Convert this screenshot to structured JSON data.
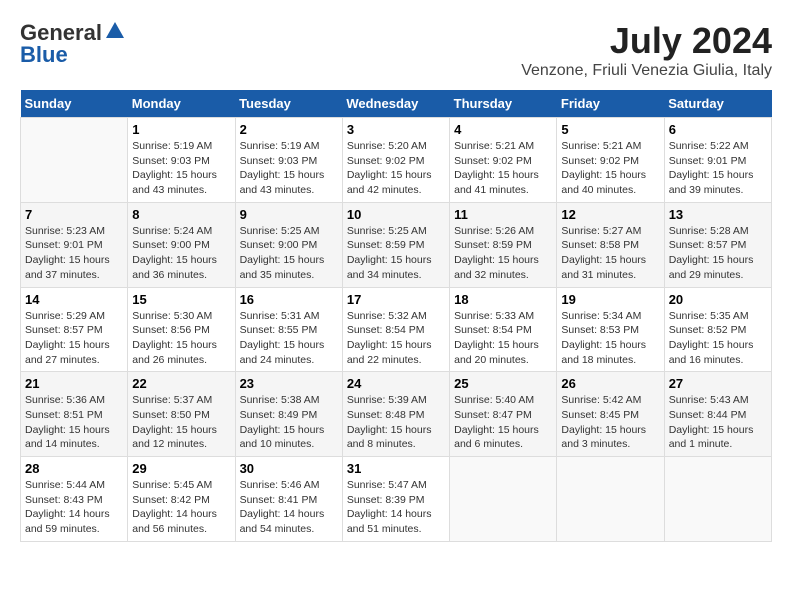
{
  "header": {
    "logo_general": "General",
    "logo_blue": "Blue",
    "month": "July 2024",
    "location": "Venzone, Friuli Venezia Giulia, Italy"
  },
  "weekdays": [
    "Sunday",
    "Monday",
    "Tuesday",
    "Wednesday",
    "Thursday",
    "Friday",
    "Saturday"
  ],
  "weeks": [
    [
      {
        "day": "",
        "sunrise": "",
        "sunset": "",
        "daylight": ""
      },
      {
        "day": "1",
        "sunrise": "Sunrise: 5:19 AM",
        "sunset": "Sunset: 9:03 PM",
        "daylight": "Daylight: 15 hours and 43 minutes."
      },
      {
        "day": "2",
        "sunrise": "Sunrise: 5:19 AM",
        "sunset": "Sunset: 9:03 PM",
        "daylight": "Daylight: 15 hours and 43 minutes."
      },
      {
        "day": "3",
        "sunrise": "Sunrise: 5:20 AM",
        "sunset": "Sunset: 9:02 PM",
        "daylight": "Daylight: 15 hours and 42 minutes."
      },
      {
        "day": "4",
        "sunrise": "Sunrise: 5:21 AM",
        "sunset": "Sunset: 9:02 PM",
        "daylight": "Daylight: 15 hours and 41 minutes."
      },
      {
        "day": "5",
        "sunrise": "Sunrise: 5:21 AM",
        "sunset": "Sunset: 9:02 PM",
        "daylight": "Daylight: 15 hours and 40 minutes."
      },
      {
        "day": "6",
        "sunrise": "Sunrise: 5:22 AM",
        "sunset": "Sunset: 9:01 PM",
        "daylight": "Daylight: 15 hours and 39 minutes."
      }
    ],
    [
      {
        "day": "7",
        "sunrise": "Sunrise: 5:23 AM",
        "sunset": "Sunset: 9:01 PM",
        "daylight": "Daylight: 15 hours and 37 minutes."
      },
      {
        "day": "8",
        "sunrise": "Sunrise: 5:24 AM",
        "sunset": "Sunset: 9:00 PM",
        "daylight": "Daylight: 15 hours and 36 minutes."
      },
      {
        "day": "9",
        "sunrise": "Sunrise: 5:25 AM",
        "sunset": "Sunset: 9:00 PM",
        "daylight": "Daylight: 15 hours and 35 minutes."
      },
      {
        "day": "10",
        "sunrise": "Sunrise: 5:25 AM",
        "sunset": "Sunset: 8:59 PM",
        "daylight": "Daylight: 15 hours and 34 minutes."
      },
      {
        "day": "11",
        "sunrise": "Sunrise: 5:26 AM",
        "sunset": "Sunset: 8:59 PM",
        "daylight": "Daylight: 15 hours and 32 minutes."
      },
      {
        "day": "12",
        "sunrise": "Sunrise: 5:27 AM",
        "sunset": "Sunset: 8:58 PM",
        "daylight": "Daylight: 15 hours and 31 minutes."
      },
      {
        "day": "13",
        "sunrise": "Sunrise: 5:28 AM",
        "sunset": "Sunset: 8:57 PM",
        "daylight": "Daylight: 15 hours and 29 minutes."
      }
    ],
    [
      {
        "day": "14",
        "sunrise": "Sunrise: 5:29 AM",
        "sunset": "Sunset: 8:57 PM",
        "daylight": "Daylight: 15 hours and 27 minutes."
      },
      {
        "day": "15",
        "sunrise": "Sunrise: 5:30 AM",
        "sunset": "Sunset: 8:56 PM",
        "daylight": "Daylight: 15 hours and 26 minutes."
      },
      {
        "day": "16",
        "sunrise": "Sunrise: 5:31 AM",
        "sunset": "Sunset: 8:55 PM",
        "daylight": "Daylight: 15 hours and 24 minutes."
      },
      {
        "day": "17",
        "sunrise": "Sunrise: 5:32 AM",
        "sunset": "Sunset: 8:54 PM",
        "daylight": "Daylight: 15 hours and 22 minutes."
      },
      {
        "day": "18",
        "sunrise": "Sunrise: 5:33 AM",
        "sunset": "Sunset: 8:54 PM",
        "daylight": "Daylight: 15 hours and 20 minutes."
      },
      {
        "day": "19",
        "sunrise": "Sunrise: 5:34 AM",
        "sunset": "Sunset: 8:53 PM",
        "daylight": "Daylight: 15 hours and 18 minutes."
      },
      {
        "day": "20",
        "sunrise": "Sunrise: 5:35 AM",
        "sunset": "Sunset: 8:52 PM",
        "daylight": "Daylight: 15 hours and 16 minutes."
      }
    ],
    [
      {
        "day": "21",
        "sunrise": "Sunrise: 5:36 AM",
        "sunset": "Sunset: 8:51 PM",
        "daylight": "Daylight: 15 hours and 14 minutes."
      },
      {
        "day": "22",
        "sunrise": "Sunrise: 5:37 AM",
        "sunset": "Sunset: 8:50 PM",
        "daylight": "Daylight: 15 hours and 12 minutes."
      },
      {
        "day": "23",
        "sunrise": "Sunrise: 5:38 AM",
        "sunset": "Sunset: 8:49 PM",
        "daylight": "Daylight: 15 hours and 10 minutes."
      },
      {
        "day": "24",
        "sunrise": "Sunrise: 5:39 AM",
        "sunset": "Sunset: 8:48 PM",
        "daylight": "Daylight: 15 hours and 8 minutes."
      },
      {
        "day": "25",
        "sunrise": "Sunrise: 5:40 AM",
        "sunset": "Sunset: 8:47 PM",
        "daylight": "Daylight: 15 hours and 6 minutes."
      },
      {
        "day": "26",
        "sunrise": "Sunrise: 5:42 AM",
        "sunset": "Sunset: 8:45 PM",
        "daylight": "Daylight: 15 hours and 3 minutes."
      },
      {
        "day": "27",
        "sunrise": "Sunrise: 5:43 AM",
        "sunset": "Sunset: 8:44 PM",
        "daylight": "Daylight: 15 hours and 1 minute."
      }
    ],
    [
      {
        "day": "28",
        "sunrise": "Sunrise: 5:44 AM",
        "sunset": "Sunset: 8:43 PM",
        "daylight": "Daylight: 14 hours and 59 minutes."
      },
      {
        "day": "29",
        "sunrise": "Sunrise: 5:45 AM",
        "sunset": "Sunset: 8:42 PM",
        "daylight": "Daylight: 14 hours and 56 minutes."
      },
      {
        "day": "30",
        "sunrise": "Sunrise: 5:46 AM",
        "sunset": "Sunset: 8:41 PM",
        "daylight": "Daylight: 14 hours and 54 minutes."
      },
      {
        "day": "31",
        "sunrise": "Sunrise: 5:47 AM",
        "sunset": "Sunset: 8:39 PM",
        "daylight": "Daylight: 14 hours and 51 minutes."
      },
      {
        "day": "",
        "sunrise": "",
        "sunset": "",
        "daylight": ""
      },
      {
        "day": "",
        "sunrise": "",
        "sunset": "",
        "daylight": ""
      },
      {
        "day": "",
        "sunrise": "",
        "sunset": "",
        "daylight": ""
      }
    ]
  ]
}
